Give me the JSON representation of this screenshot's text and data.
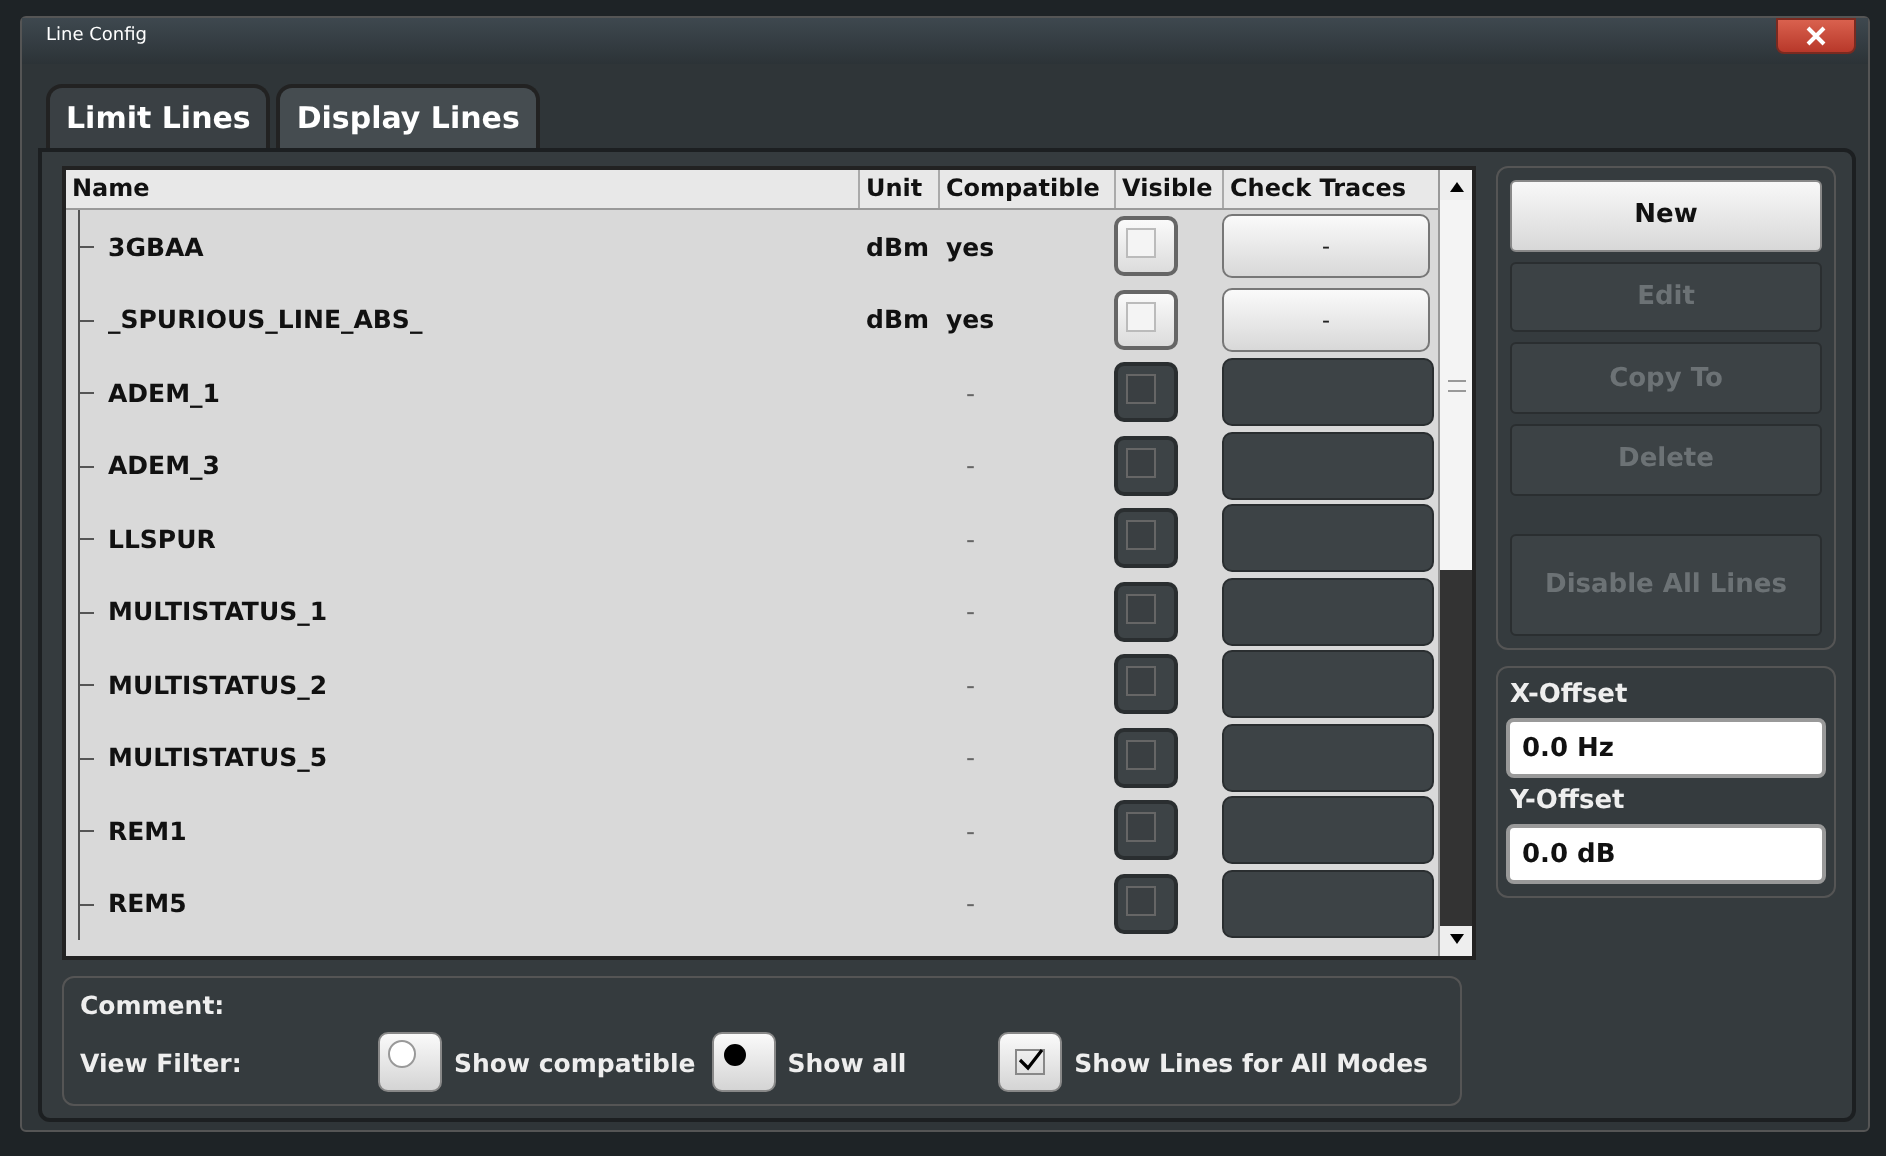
{
  "window": {
    "title": "Line Config"
  },
  "tabs": [
    {
      "label": "Limit Lines",
      "selected": true
    },
    {
      "label": "Display Lines",
      "selected": false
    }
  ],
  "table": {
    "columns": [
      "Name",
      "Unit",
      "Compatible",
      "Visible",
      "Check Traces"
    ],
    "rows": [
      {
        "name": "3GBAA",
        "unit": "dBm",
        "compatible": "yes",
        "enabled": true,
        "visible": false,
        "check_traces": "-"
      },
      {
        "name": "_SPURIOUS_LINE_ABS_",
        "unit": "dBm",
        "compatible": "yes",
        "enabled": true,
        "visible": false,
        "check_traces": "-"
      },
      {
        "name": "ADEM_1",
        "compatible": "-",
        "enabled": false,
        "visible": false
      },
      {
        "name": "ADEM_3",
        "compatible": "-",
        "enabled": false,
        "visible": false
      },
      {
        "name": "LLSPUR",
        "compatible": "-",
        "enabled": false,
        "visible": false
      },
      {
        "name": "MULTISTATUS_1",
        "compatible": "-",
        "enabled": false,
        "visible": false
      },
      {
        "name": "MULTISTATUS_2",
        "compatible": "-",
        "enabled": false,
        "visible": false
      },
      {
        "name": "MULTISTATUS_5",
        "compatible": "-",
        "enabled": false,
        "visible": false
      },
      {
        "name": "REM1",
        "compatible": "-",
        "enabled": false,
        "visible": false
      },
      {
        "name": "REM5",
        "compatible": "-",
        "enabled": false,
        "visible": false
      }
    ]
  },
  "actions": [
    {
      "label": "New",
      "disabled": false
    },
    {
      "label": "Edit",
      "disabled": true
    },
    {
      "label": "Copy To",
      "disabled": true
    },
    {
      "label": "Delete",
      "disabled": true
    },
    {
      "label": "Disable All Lines",
      "disabled": true
    }
  ],
  "offsets": [
    {
      "label": "X-Offset",
      "value": "0.0 Hz"
    },
    {
      "label": "Y-Offset",
      "value": "0.0 dB"
    }
  ],
  "comment": {
    "label": "Comment:"
  },
  "view_filter": {
    "label": "View Filter:",
    "options": [
      {
        "label": "Show compatible",
        "selected": false
      },
      {
        "label": "Show all",
        "selected": true
      }
    ],
    "all_modes": {
      "label": "Show Lines for All Modes",
      "checked": true
    }
  }
}
